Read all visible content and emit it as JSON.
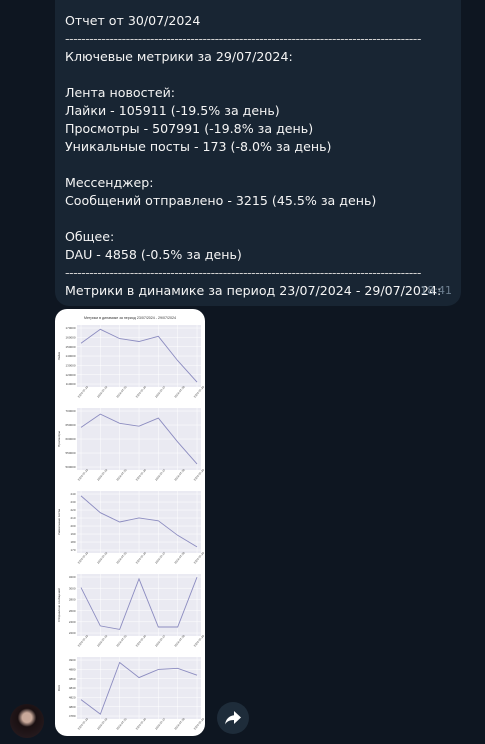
{
  "message": {
    "lines": [
      "Отчет от 30/07/2024",
      "---",
      "Ключевые метрики за 29/07/2024:",
      "",
      "Лента новостей:",
      "Лайки - 105911 (-19.5% за день)",
      "Просмотры - 507991 (-19.8% за день)",
      "Уникальные посты - 173 (-8.0% за день)",
      "",
      "Мессенджер:",
      "Сообщений отправлено - 3215 (45.5% за день)",
      "",
      "Общее:",
      "DAU - 4858 (-0.5% за день)",
      "---",
      "Метрики в динамике за период 23/07/2024 - 29/07/2024:"
    ],
    "divider": "----------------------------------------------------------------------------------------",
    "time": "18:41"
  },
  "figure": {
    "title": "Метрики в динамике за период 23/07/2024 - 29/07/2024",
    "dates": [
      "2024-07-23",
      "2024-07-24",
      "2024-07-25",
      "2024-07-26",
      "2024-07-27",
      "2024-07-28",
      "2024-07-29"
    ],
    "panels": [
      {
        "ylabel": "Лайки",
        "yticks": [
          "170000",
          "160000",
          "150000",
          "140000",
          "130000",
          "120000",
          "110000"
        ],
        "values": [
          0.72,
          0.96,
          0.8,
          0.75,
          0.84,
          0.42,
          0.05
        ]
      },
      {
        "ylabel": "Просмотры",
        "yticks": [
          "700000",
          "650000",
          "600000",
          "550000",
          "500000"
        ],
        "values": [
          0.7,
          0.93,
          0.77,
          0.72,
          0.86,
          0.45,
          0.07
        ]
      },
      {
        "ylabel": "Уникальные посты",
        "yticks": [
          "240",
          "230",
          "220",
          "210",
          "200",
          "190",
          "180",
          "170"
        ],
        "values": [
          0.95,
          0.66,
          0.5,
          0.57,
          0.52,
          0.27,
          0.07
        ]
      },
      {
        "ylabel": "Отправлено сообщений",
        "yticks": [
          "3200",
          "3000",
          "2800",
          "2600",
          "2400",
          "2200"
        ],
        "values": [
          0.8,
          0.14,
          0.08,
          0.95,
          0.12,
          0.12,
          0.98
        ]
      },
      {
        "ylabel": "DAU",
        "yticks": [
          "4900",
          "4880",
          "4860",
          "4840",
          "4820",
          "4800",
          "4780"
        ],
        "values": [
          0.3,
          0.05,
          0.94,
          0.68,
          0.82,
          0.84,
          0.72
        ]
      }
    ]
  },
  "chart_data": {
    "type": "line",
    "title": "Метрики в динамике за период 23/07/2024 - 29/07/2024",
    "x": [
      "2024-07-23",
      "2024-07-24",
      "2024-07-25",
      "2024-07-26",
      "2024-07-27",
      "2024-07-28",
      "2024-07-29"
    ],
    "series": [
      {
        "name": "Лайки",
        "values": [
          146000,
          166000,
          152000,
          148000,
          156000,
          123000,
          95000
        ]
      },
      {
        "name": "Просмотры",
        "values": [
          675000,
          740000,
          690000,
          675000,
          700000,
          600000,
          520000
        ]
      },
      {
        "name": "Уникальные посты",
        "values": [
          242,
          224,
          214,
          217,
          214,
          200,
          186
        ]
      },
      {
        "name": "Отправлено сообщений",
        "values": [
          3050,
          2300,
          2250,
          3200,
          2280,
          2250,
          3215
        ]
      },
      {
        "name": "DAU",
        "values": [
          4790,
          4770,
          4905,
          4870,
          4885,
          4885,
          4860
        ]
      }
    ]
  },
  "icons": {
    "share": "share-icon",
    "avatar": "avatar"
  },
  "colors": {
    "background": "#0e1621",
    "bubble": "#182533",
    "line": "#8c8cc0",
    "plot_bg": "#eaeaf2"
  }
}
